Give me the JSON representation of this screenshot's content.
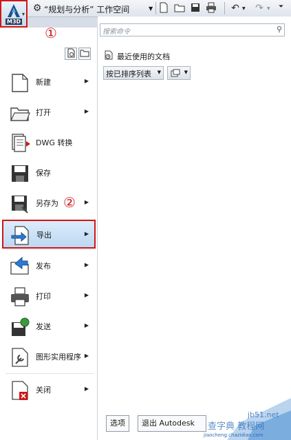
{
  "toolbar": {
    "app_badge": "M3D",
    "workspace_label": "“规划与分析” 工作空间",
    "icons": [
      "gear-icon",
      "new-file-icon",
      "open-folder-icon",
      "save-icon",
      "print-icon",
      "undo-icon",
      "redo-icon",
      "dropdown-icon"
    ]
  },
  "annotations": {
    "circle1": "①",
    "circle2": "②"
  },
  "menu": {
    "items": [
      {
        "label": "新建",
        "icon": "new-document-icon",
        "has_submenu": true
      },
      {
        "label": "打开",
        "icon": "open-folder-icon",
        "has_submenu": true
      },
      {
        "label": "DWG 转换",
        "icon": "dwg-convert-icon",
        "has_submenu": false
      },
      {
        "label": "保存",
        "icon": "save-icon",
        "has_submenu": false
      },
      {
        "label": "另存为",
        "icon": "save-as-icon",
        "has_submenu": true
      },
      {
        "label": "导出",
        "icon": "export-icon",
        "has_submenu": true,
        "highlighted": true
      },
      {
        "label": "发布",
        "icon": "publish-icon",
        "has_submenu": true
      },
      {
        "label": "打印",
        "icon": "print-icon",
        "has_submenu": true
      },
      {
        "label": "发送",
        "icon": "send-icon",
        "has_submenu": true
      },
      {
        "label": "图形实用程序",
        "icon": "drawing-utilities-icon",
        "has_submenu": true
      },
      {
        "label": "关闭",
        "icon": "close-document-icon",
        "has_submenu": true
      }
    ]
  },
  "search": {
    "placeholder": "搜索命令"
  },
  "recent": {
    "title": "最近使用的文档",
    "sort_value": "按已排序列表"
  },
  "footer": {
    "options_label": "选项",
    "exit_label": "退出 Autodesk"
  },
  "watermark": {
    "site": "jb51.net",
    "main": "查字典 教程网",
    "sub": "jiaocheng.chazidian.com"
  },
  "colors": {
    "highlight_border": "#d01515",
    "selected_bg": "#c4dcf5",
    "accent_blue": "#2b6cb5"
  }
}
